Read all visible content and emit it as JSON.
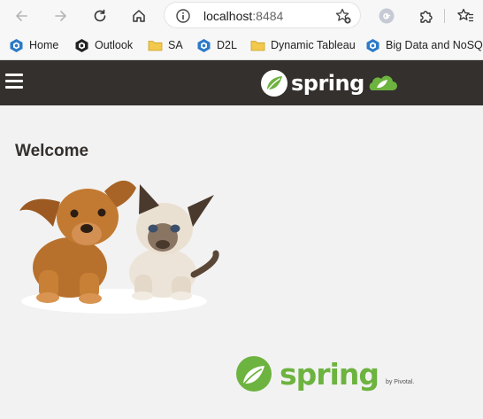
{
  "browser": {
    "icons": {
      "back": "back-arrow-icon",
      "forward": "forward-arrow-icon",
      "reload": "reload-icon",
      "home": "home-icon",
      "site_info": "info-icon",
      "add_favorite": "star-plus-icon",
      "profile": "profile-g-icon",
      "extensions": "puzzle-icon",
      "favorites": "favorites-star-icon"
    },
    "address": {
      "host": "localhost",
      "port": ":8484"
    },
    "bookmarks": [
      {
        "label": "Home",
        "icon": "cube-icon"
      },
      {
        "label": "Outlook",
        "icon": "cube-dark-icon"
      },
      {
        "label": "SA",
        "icon": "folder-icon"
      },
      {
        "label": "D2L",
        "icon": "cube-icon"
      },
      {
        "label": "Dynamic Tableau",
        "icon": "folder-icon"
      },
      {
        "label": "Big Data and NoSQ...",
        "icon": "cube-icon"
      }
    ]
  },
  "header": {
    "brand": "spring",
    "menu_icon": "hamburger-icon",
    "bg_color": "#34302d"
  },
  "content": {
    "heading": "Welcome",
    "image": "puppy-and-kitten-image"
  },
  "footer": {
    "brand": "spring",
    "by": "by Pivotal.",
    "brand_color": "#6db33f"
  }
}
